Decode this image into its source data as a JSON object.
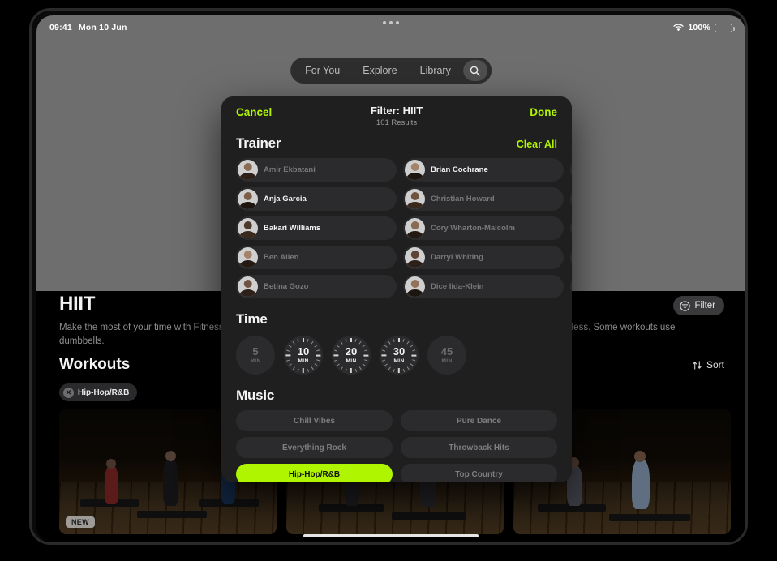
{
  "status_bar": {
    "time": "09:41",
    "date": "Mon 10 Jun",
    "wifi_icon": "wifi-icon",
    "battery_percent": "100%",
    "battery_icon": "battery-icon",
    "multitask_icon": "multitask-dots-icon"
  },
  "tab_bar": {
    "tabs": [
      {
        "label": "For You"
      },
      {
        "label": "Explore"
      },
      {
        "label": "Library"
      }
    ],
    "search_icon": "search-icon"
  },
  "hero": {
    "title": "HIIT",
    "description": "Make the most of your time with Fitness+ HIIT workouts. Increase cardio fitness and total-body strength, all in 30 minutes or less. Some workouts use dumbbells.",
    "filter_button": {
      "label": "Filter",
      "icon": "filter-funnel-icon"
    }
  },
  "workouts": {
    "heading": "Workouts",
    "sort_button": {
      "label": "Sort",
      "icon": "sort-arrows-icon"
    },
    "active_filter_chip": {
      "label": "Hip-Hop/R&B",
      "remove_icon": "close-circle-icon"
    },
    "thumbnails": [
      {
        "badge": "NEW"
      },
      {
        "badge": ""
      },
      {
        "badge": ""
      }
    ]
  },
  "modal": {
    "cancel_label": "Cancel",
    "done_label": "Done",
    "title": "Filter: HIIT",
    "subtitle": "101 Results",
    "clear_all_label": "Clear All",
    "trainer_section": {
      "heading": "Trainer",
      "columns": [
        [
          {
            "name": "Amir Ekbatani",
            "selected": false
          },
          {
            "name": "Anja Garcia",
            "selected": true
          },
          {
            "name": "Bakari Williams",
            "selected": true
          },
          {
            "name": "Ben Allen",
            "selected": false
          },
          {
            "name": "Betina Gozo",
            "selected": false
          }
        ],
        [
          {
            "name": "Brian Cochrane",
            "selected": true
          },
          {
            "name": "Christian Howard",
            "selected": false
          },
          {
            "name": "Cory Wharton-Malcolm",
            "selected": false
          },
          {
            "name": "Darryl Whiting",
            "selected": false
          },
          {
            "name": "Dice Iida-Klein",
            "selected": false
          }
        ],
        [
          {
            "name": "",
            "selected": false
          },
          {
            "name": "",
            "selected": false
          },
          {
            "name": "",
            "selected": false
          },
          {
            "name": "",
            "selected": false
          },
          {
            "name": "",
            "selected": false
          }
        ]
      ]
    },
    "time_section": {
      "heading": "Time",
      "unit": "MIN",
      "options": [
        {
          "value": "5",
          "enabled": false
        },
        {
          "value": "10",
          "enabled": true
        },
        {
          "value": "20",
          "enabled": true
        },
        {
          "value": "30",
          "enabled": true
        },
        {
          "value": "45",
          "enabled": false
        }
      ]
    },
    "music_section": {
      "heading": "Music",
      "options": [
        {
          "label": "Chill Vibes",
          "selected": false
        },
        {
          "label": "Pure Dance",
          "selected": false
        },
        {
          "label": "Everything Rock",
          "selected": false
        },
        {
          "label": "Throwback Hits",
          "selected": false
        },
        {
          "label": "Hip-Hop/R&B",
          "selected": true
        },
        {
          "label": "Top Country",
          "selected": false
        }
      ]
    }
  },
  "colors": {
    "accent_green": "#b0f500",
    "modal_bg": "#1f1f1f",
    "pill_bg": "#2b2b2d",
    "text_on": "#f4f4f4",
    "text_off": "#787878"
  }
}
